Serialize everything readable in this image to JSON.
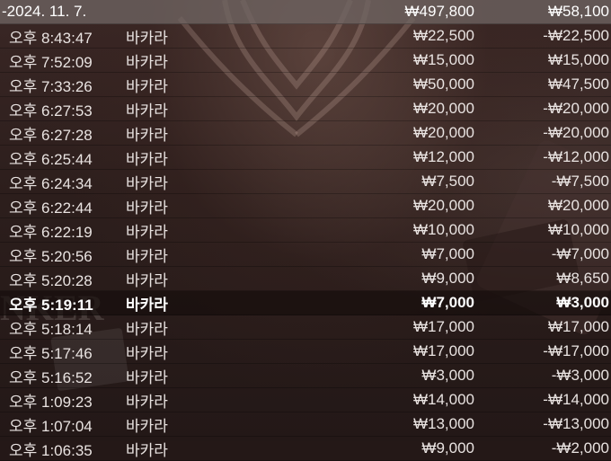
{
  "header": {
    "date": "-2024. 11. 7.",
    "total_bet": "₩497,800",
    "total_result": "₩58,100"
  },
  "rows": [
    {
      "time": "오후 8:43:47",
      "game": "바카라",
      "bet": "₩22,500",
      "result": "-₩22,500"
    },
    {
      "time": "오후 7:52:09",
      "game": "바카라",
      "bet": "₩15,000",
      "result": "₩15,000"
    },
    {
      "time": "오후 7:33:26",
      "game": "바카라",
      "bet": "₩50,000",
      "result": "₩47,500"
    },
    {
      "time": "오후 6:27:53",
      "game": "바카라",
      "bet": "₩20,000",
      "result": "-₩20,000"
    },
    {
      "time": "오후 6:27:28",
      "game": "바카라",
      "bet": "₩20,000",
      "result": "-₩20,000"
    },
    {
      "time": "오후 6:25:44",
      "game": "바카라",
      "bet": "₩12,000",
      "result": "-₩12,000"
    },
    {
      "time": "오후 6:24:34",
      "game": "바카라",
      "bet": "₩7,500",
      "result": "-₩7,500"
    },
    {
      "time": "오후 6:22:44",
      "game": "바카라",
      "bet": "₩20,000",
      "result": "₩20,000"
    },
    {
      "time": "오후 6:22:19",
      "game": "바카라",
      "bet": "₩10,000",
      "result": "₩10,000"
    },
    {
      "time": "오후 5:20:56",
      "game": "바카라",
      "bet": "₩7,000",
      "result": "-₩7,000"
    },
    {
      "time": "오후 5:20:28",
      "game": "바카라",
      "bet": "₩9,000",
      "result": "₩8,650"
    },
    {
      "time": "오후 5:19:11",
      "game": "바카라",
      "bet": "₩7,000",
      "result": "₩3,000"
    },
    {
      "time": "오후 5:18:14",
      "game": "바카라",
      "bet": "₩17,000",
      "result": "₩17,000"
    },
    {
      "time": "오후 5:17:46",
      "game": "바카라",
      "bet": "₩17,000",
      "result": "-₩17,000"
    },
    {
      "time": "오후 5:16:52",
      "game": "바카라",
      "bet": "₩3,000",
      "result": "-₩3,000"
    },
    {
      "time": "오후 1:09:23",
      "game": "바카라",
      "bet": "₩14,000",
      "result": "-₩14,000"
    },
    {
      "time": "오후 1:07:04",
      "game": "바카라",
      "bet": "₩13,000",
      "result": "-₩13,000"
    },
    {
      "time": "오후 1:06:35",
      "game": "바카라",
      "bet": "₩9,000",
      "result": "-₩2,000"
    }
  ],
  "background_text": "NKER"
}
